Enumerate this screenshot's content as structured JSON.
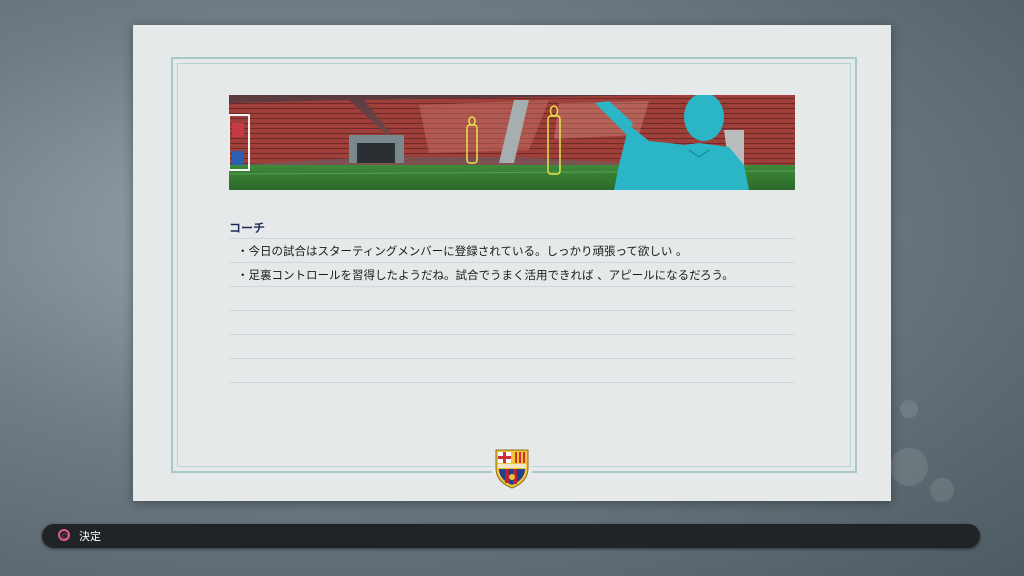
{
  "card": {
    "section_title": "コーチ",
    "messages": [
      "・今日の試合はスターティングメンバーに登録されている。しっかり頑張って欲しい 。",
      "・足裏コントロールを習得したようだね。試合でうまく活用できれば 、アピールになるだろう。"
    ]
  },
  "bottom_bar": {
    "confirm_label": "決定",
    "confirm_icon": "circle-button-icon"
  },
  "colors": {
    "accent_title": "#1f2a58",
    "frame": "#a9c9c6",
    "coach_silhouette": "#2bb6c8",
    "circle_button": "#e05a8c"
  }
}
